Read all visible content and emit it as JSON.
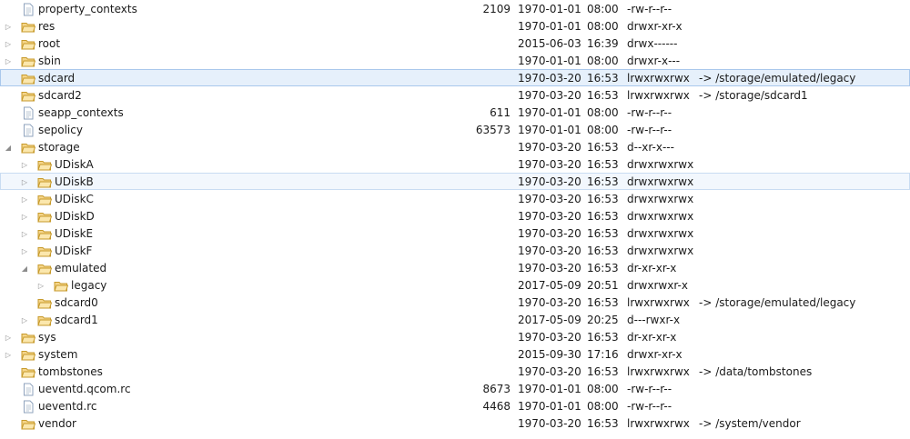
{
  "colors": {
    "folder_fill": "#f5d58a",
    "folder_edge": "#c79a2b",
    "file_edge": "#8fa3bd",
    "selection": "#e6f0fb"
  },
  "rows": [
    {
      "name": "property_contexts",
      "level": 0,
      "type": "file",
      "twisty": "",
      "size": "2109",
      "date": "1970-01-01",
      "time": "08:00",
      "perms": "-rw-r--r--",
      "link": ""
    },
    {
      "name": "res",
      "level": 0,
      "type": "folder",
      "twisty": "collapsed",
      "size": "",
      "date": "1970-01-01",
      "time": "08:00",
      "perms": "drwxr-xr-x",
      "link": ""
    },
    {
      "name": "root",
      "level": 0,
      "type": "folder",
      "twisty": "collapsed",
      "size": "",
      "date": "2015-06-03",
      "time": "16:39",
      "perms": "drwx------",
      "link": ""
    },
    {
      "name": "sbin",
      "level": 0,
      "type": "folder",
      "twisty": "collapsed",
      "size": "",
      "date": "1970-01-01",
      "time": "08:00",
      "perms": "drwxr-x---",
      "link": ""
    },
    {
      "name": "sdcard",
      "level": 0,
      "type": "folder",
      "twisty": "",
      "size": "",
      "date": "1970-03-20",
      "time": "16:53",
      "perms": "lrwxrwxrwx",
      "link": "-> /storage/emulated/legacy",
      "state": "selected"
    },
    {
      "name": "sdcard2",
      "level": 0,
      "type": "folder",
      "twisty": "",
      "size": "",
      "date": "1970-03-20",
      "time": "16:53",
      "perms": "lrwxrwxrwx",
      "link": "-> /storage/sdcard1"
    },
    {
      "name": "seapp_contexts",
      "level": 0,
      "type": "file",
      "twisty": "",
      "size": "611",
      "date": "1970-01-01",
      "time": "08:00",
      "perms": "-rw-r--r--",
      "link": ""
    },
    {
      "name": "sepolicy",
      "level": 0,
      "type": "file",
      "twisty": "",
      "size": "63573",
      "date": "1970-01-01",
      "time": "08:00",
      "perms": "-rw-r--r--",
      "link": ""
    },
    {
      "name": "storage",
      "level": 0,
      "type": "folder",
      "twisty": "expanded",
      "size": "",
      "date": "1970-03-20",
      "time": "16:53",
      "perms": "d--xr-x---",
      "link": ""
    },
    {
      "name": "UDiskA",
      "level": 1,
      "type": "folder",
      "twisty": "collapsed",
      "size": "",
      "date": "1970-03-20",
      "time": "16:53",
      "perms": "drwxrwxrwx",
      "link": ""
    },
    {
      "name": "UDiskB",
      "level": 1,
      "type": "folder",
      "twisty": "collapsed",
      "size": "",
      "date": "1970-03-20",
      "time": "16:53",
      "perms": "drwxrwxrwx",
      "link": "",
      "state": "hover"
    },
    {
      "name": "UDiskC",
      "level": 1,
      "type": "folder",
      "twisty": "collapsed",
      "size": "",
      "date": "1970-03-20",
      "time": "16:53",
      "perms": "drwxrwxrwx",
      "link": ""
    },
    {
      "name": "UDiskD",
      "level": 1,
      "type": "folder",
      "twisty": "collapsed",
      "size": "",
      "date": "1970-03-20",
      "time": "16:53",
      "perms": "drwxrwxrwx",
      "link": ""
    },
    {
      "name": "UDiskE",
      "level": 1,
      "type": "folder",
      "twisty": "collapsed",
      "size": "",
      "date": "1970-03-20",
      "time": "16:53",
      "perms": "drwxrwxrwx",
      "link": ""
    },
    {
      "name": "UDiskF",
      "level": 1,
      "type": "folder",
      "twisty": "collapsed",
      "size": "",
      "date": "1970-03-20",
      "time": "16:53",
      "perms": "drwxrwxrwx",
      "link": ""
    },
    {
      "name": "emulated",
      "level": 1,
      "type": "folder",
      "twisty": "expanded",
      "size": "",
      "date": "1970-03-20",
      "time": "16:53",
      "perms": "dr-xr-xr-x",
      "link": ""
    },
    {
      "name": "legacy",
      "level": 2,
      "type": "folder",
      "twisty": "collapsed",
      "size": "",
      "date": "2017-05-09",
      "time": "20:51",
      "perms": "drwxrwxr-x",
      "link": ""
    },
    {
      "name": "sdcard0",
      "level": 1,
      "type": "folder",
      "twisty": "",
      "size": "",
      "date": "1970-03-20",
      "time": "16:53",
      "perms": "lrwxrwxrwx",
      "link": "-> /storage/emulated/legacy"
    },
    {
      "name": "sdcard1",
      "level": 1,
      "type": "folder",
      "twisty": "collapsed",
      "size": "",
      "date": "2017-05-09",
      "time": "20:25",
      "perms": "d---rwxr-x",
      "link": ""
    },
    {
      "name": "sys",
      "level": 0,
      "type": "folder",
      "twisty": "collapsed",
      "size": "",
      "date": "1970-03-20",
      "time": "16:53",
      "perms": "dr-xr-xr-x",
      "link": ""
    },
    {
      "name": "system",
      "level": 0,
      "type": "folder",
      "twisty": "collapsed",
      "size": "",
      "date": "2015-09-30",
      "time": "17:16",
      "perms": "drwxr-xr-x",
      "link": ""
    },
    {
      "name": "tombstones",
      "level": 0,
      "type": "folder",
      "twisty": "",
      "size": "",
      "date": "1970-03-20",
      "time": "16:53",
      "perms": "lrwxrwxrwx",
      "link": "-> /data/tombstones"
    },
    {
      "name": "ueventd.qcom.rc",
      "level": 0,
      "type": "file",
      "twisty": "",
      "size": "8673",
      "date": "1970-01-01",
      "time": "08:00",
      "perms": "-rw-r--r--",
      "link": ""
    },
    {
      "name": "ueventd.rc",
      "level": 0,
      "type": "file",
      "twisty": "",
      "size": "4468",
      "date": "1970-01-01",
      "time": "08:00",
      "perms": "-rw-r--r--",
      "link": ""
    },
    {
      "name": "vendor",
      "level": 0,
      "type": "folder",
      "twisty": "",
      "size": "",
      "date": "1970-03-20",
      "time": "16:53",
      "perms": "lrwxrwxrwx",
      "link": "-> /system/vendor"
    }
  ]
}
